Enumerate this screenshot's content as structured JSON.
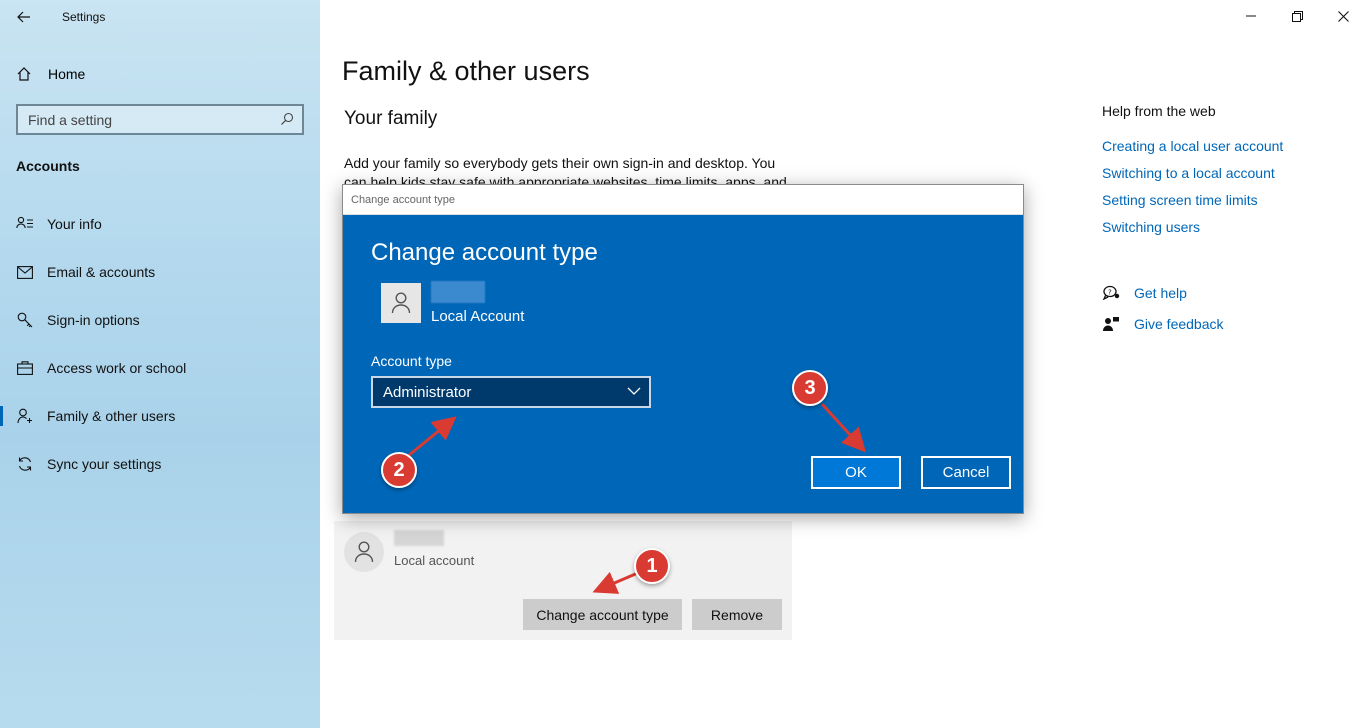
{
  "window": {
    "app_title": "Settings"
  },
  "sidebar": {
    "home_label": "Home",
    "search_placeholder": "Find a setting",
    "section_title": "Accounts",
    "items": [
      {
        "label": "Your info",
        "icon": "person-list-icon"
      },
      {
        "label": "Email & accounts",
        "icon": "mail-icon"
      },
      {
        "label": "Sign-in options",
        "icon": "key-icon"
      },
      {
        "label": "Access work or school",
        "icon": "briefcase-icon"
      },
      {
        "label": "Family & other users",
        "icon": "person-add-icon",
        "active": true
      },
      {
        "label": "Sync your settings",
        "icon": "sync-icon"
      }
    ]
  },
  "main": {
    "page_title": "Family & other users",
    "family_heading": "Your family",
    "family_description": "Add your family so everybody gets their own sign-in and desktop. You can help kids stay safe with appropriate websites, time limits, apps, and"
  },
  "help": {
    "title": "Help from the web",
    "links": [
      "Creating a local user account",
      "Switching to a local account",
      "Setting screen time limits",
      "Switching users"
    ],
    "get_help": "Get help",
    "give_feedback": "Give feedback"
  },
  "user_card": {
    "account_label": "Local account",
    "change_button": "Change account type",
    "remove_button": "Remove"
  },
  "dialog": {
    "window_title": "Change account type",
    "heading": "Change account type",
    "account_label": "Local Account",
    "type_label": "Account type",
    "selected_type": "Administrator",
    "ok_label": "OK",
    "cancel_label": "Cancel"
  },
  "annotations": {
    "step1": "1",
    "step2": "2",
    "step3": "3",
    "color": "#d93a32"
  },
  "colors": {
    "accent": "#0067b8",
    "dialog_bg": "#0067b8",
    "link": "#0067b8"
  }
}
